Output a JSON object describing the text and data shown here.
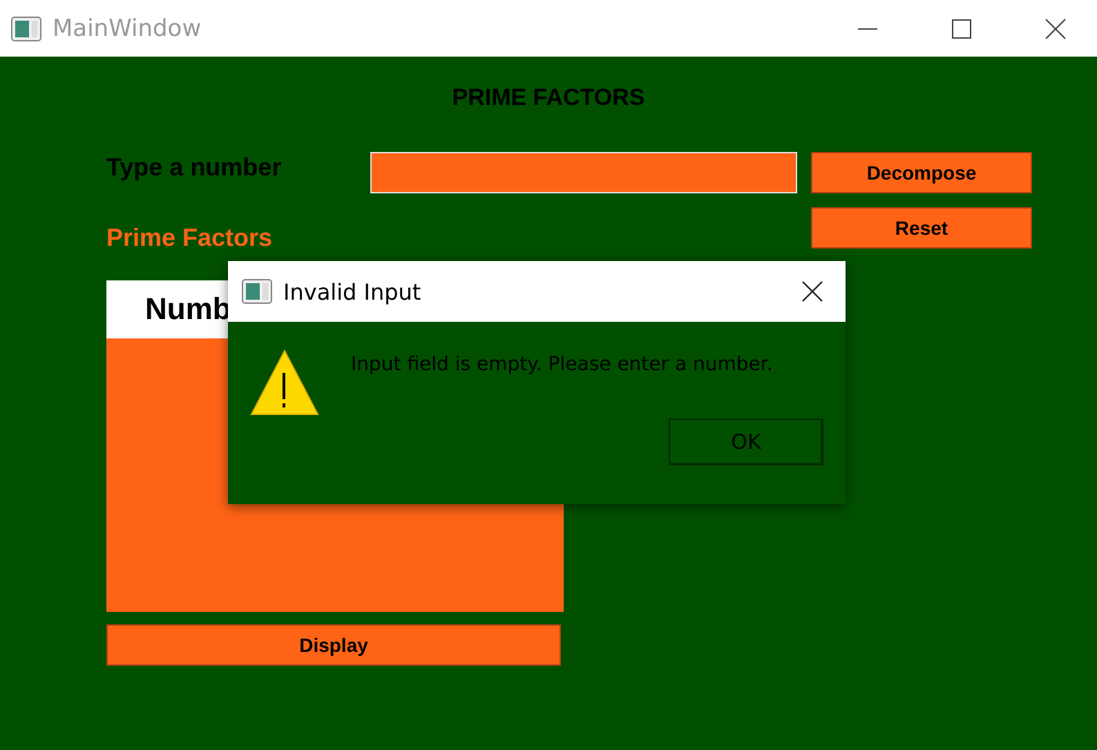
{
  "window": {
    "title": "MainWindow"
  },
  "heading": "PRIME FACTORS",
  "number_label": "Type a number",
  "buttons": {
    "decompose": "Decompose",
    "reset": "Reset",
    "display": "Display"
  },
  "factors_label": "Prime Factors",
  "factors_list": {
    "header": "Numb"
  },
  "dialog": {
    "title": "Invalid Input",
    "message": "Input field is empty. Please enter a number.",
    "ok": "OK"
  }
}
